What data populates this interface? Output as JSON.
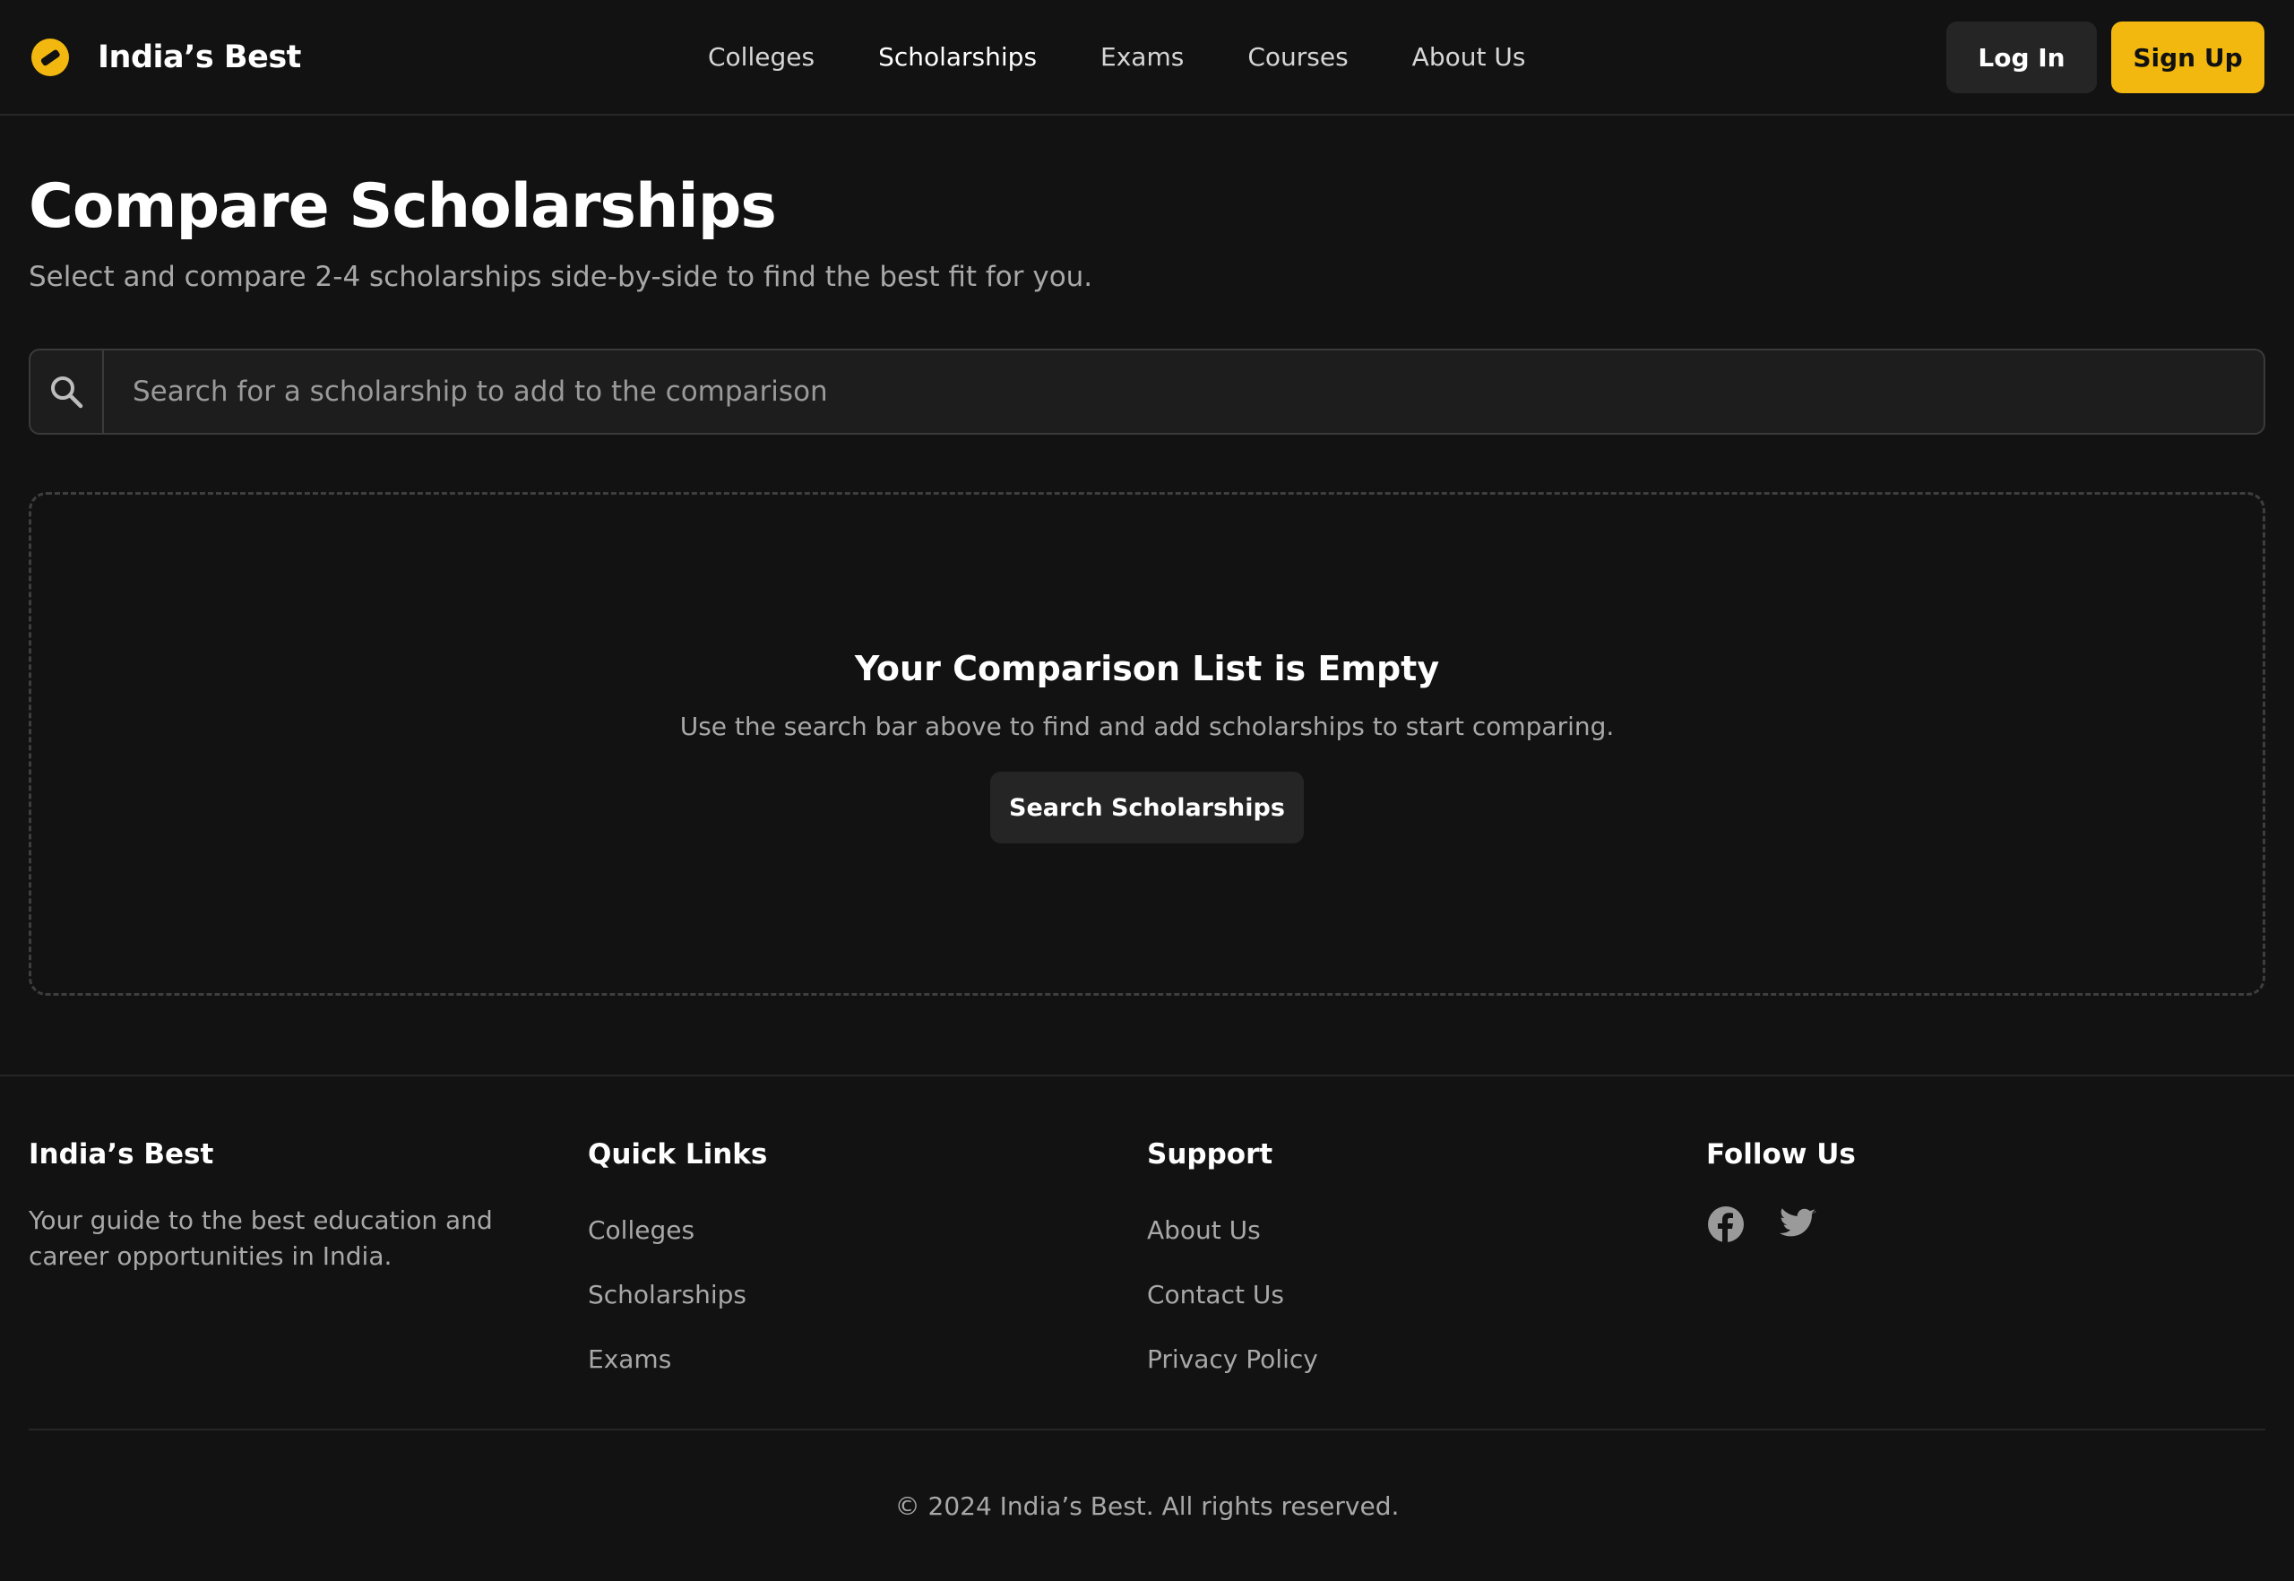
{
  "brand": {
    "name": "India’s Best",
    "logo_icon": "tag-icon",
    "accent": "#f2b80f"
  },
  "nav": {
    "items": [
      {
        "label": "Colleges"
      },
      {
        "label": "Scholarships"
      },
      {
        "label": "Exams"
      },
      {
        "label": "Courses"
      },
      {
        "label": "About Us"
      }
    ],
    "active": "Scholarships"
  },
  "header": {
    "login_label": "Log In",
    "signup_label": "Sign Up"
  },
  "main": {
    "title": "Compare Scholarships",
    "subtitle": "Select and compare 2-4 scholarships side-by-side to find the best fit for you.",
    "search": {
      "placeholder": "Search for a scholarship to add to the comparison",
      "value": "",
      "icon": "search-icon"
    },
    "empty": {
      "title": "Your Comparison List is Empty",
      "text": "Use the search bar above to find and add scholarships to start comparing.",
      "button_label": "Search Scholarships"
    }
  },
  "footer": {
    "brand": {
      "heading": "India’s Best",
      "description": "Your guide to the best education and career opportunities in India."
    },
    "quick_links": {
      "heading": "Quick Links",
      "items": [
        {
          "label": "Colleges"
        },
        {
          "label": "Scholarships"
        },
        {
          "label": "Exams"
        }
      ]
    },
    "support": {
      "heading": "Support",
      "items": [
        {
          "label": "About Us"
        },
        {
          "label": "Contact Us"
        },
        {
          "label": "Privacy Policy"
        }
      ]
    },
    "follow": {
      "heading": "Follow Us",
      "icons": [
        "facebook-icon",
        "twitter-icon"
      ]
    },
    "copyright": "© 2024 India’s Best. All rights reserved."
  },
  "colors": {
    "background": "#121212",
    "surface": "#252525",
    "accent": "#f2b80f",
    "muted_text": "#a8a8a8"
  }
}
